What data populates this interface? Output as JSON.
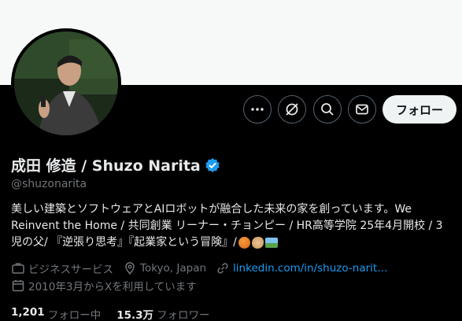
{
  "header": {
    "follow_label": "フォロー"
  },
  "profile": {
    "display_name": "成田 修造 / Shuzo Narita",
    "handle": "@shuzonarita",
    "bio_lines": [
      "美しい建築とソフトウェアとAIロボットが融合した未来の家を創っています。We",
      "Reinvent the Home / 共同創業 リーナー・チョンピー / HR高等学院 25年4月開校 / 3",
      "児の父/ 『逆張り思考』『起業家という冒険』/ "
    ],
    "category": "ビジネスサービス",
    "location": "Tokyo, Japan",
    "website": "linkedin.com/in/shuzo-narit…",
    "joined": "2010年3月からXを利用しています"
  },
  "stats": {
    "following_count": "1,201",
    "following_label": "フォロー中",
    "followers_count": "15.3万",
    "followers_label": "フォロワー"
  },
  "icons": {
    "more": "more-icon",
    "grok": "grok-icon",
    "search": "search-icon",
    "message": "message-icon",
    "verified": "verified-badge-icon",
    "category": "briefcase-icon",
    "location": "location-pin-icon",
    "website": "link-icon",
    "joined": "calendar-icon"
  },
  "colors": {
    "background": "#000000",
    "banner": "#f7f9f9",
    "accent_link": "#1d9bf0",
    "verified": "#1d9bf0",
    "secondary_text": "#71767b",
    "primary_text": "#e7e9ea",
    "follow_button_bg": "#eff3f4"
  }
}
